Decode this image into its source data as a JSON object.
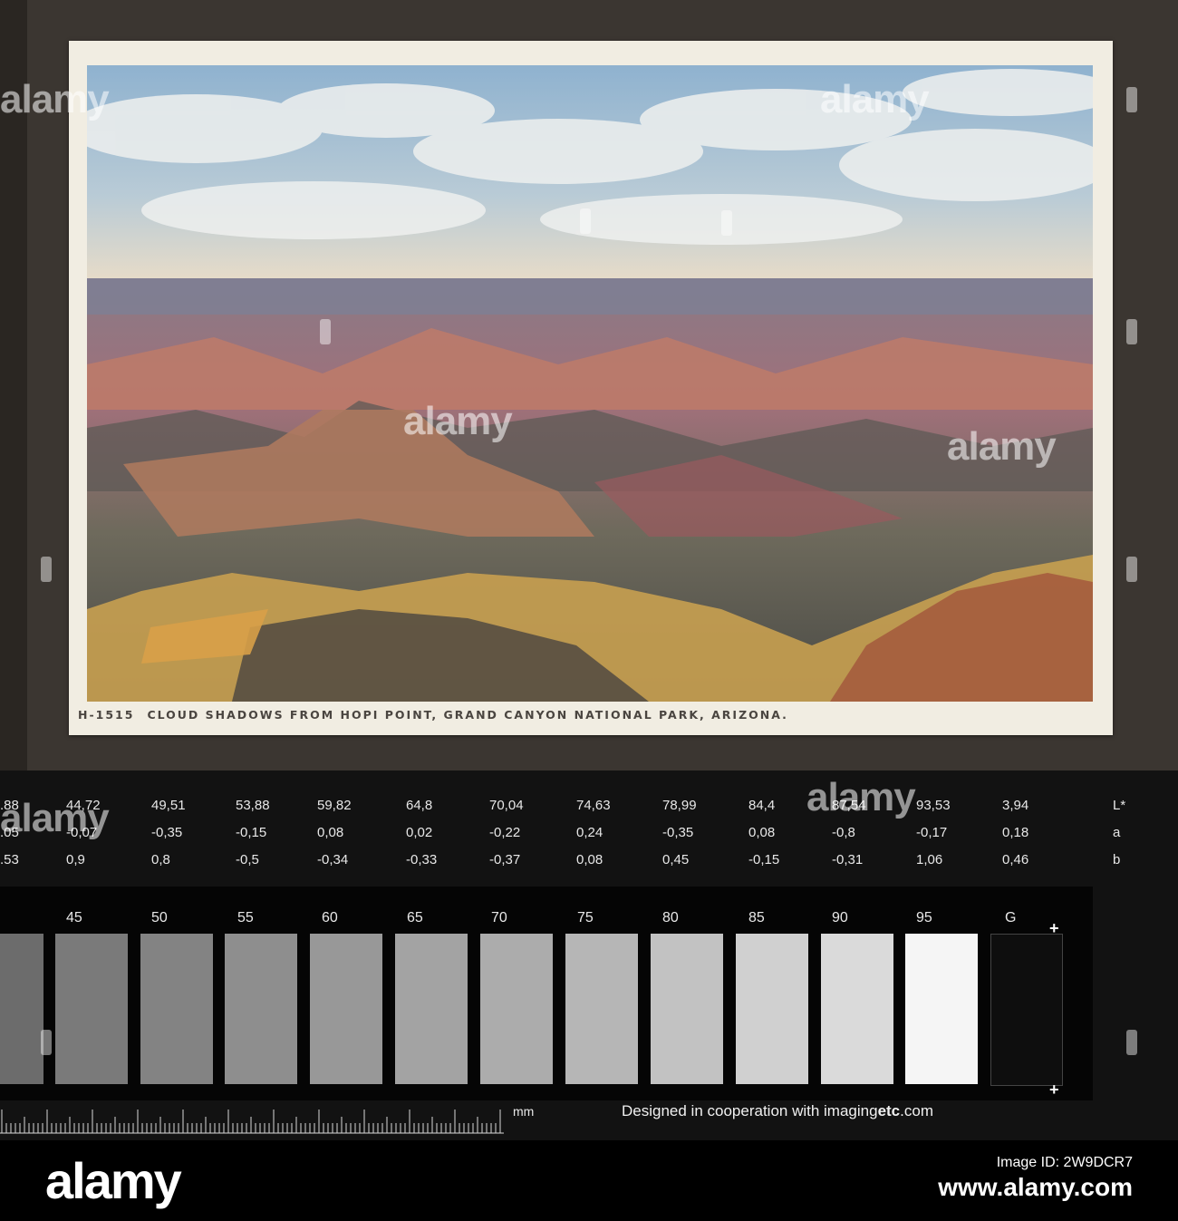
{
  "postcard": {
    "code": "H-1515",
    "caption": "CLOUD SHADOWS FROM HOPI POINT, GRAND CANYON NATIONAL PARK, ARIZONA."
  },
  "color_target": {
    "rows": [
      {
        "label": "L*",
        "values": [
          ".88",
          "44,72",
          "49,51",
          "53,88",
          "59,82",
          "64,8",
          "70,04",
          "74,63",
          "78,99",
          "84,4",
          "87,54",
          "93,53",
          "3,94"
        ]
      },
      {
        "label": "a",
        "values": [
          ".05",
          "-0,07",
          "-0,35",
          "-0,15",
          "0,08",
          "0,02",
          "-0,22",
          "0,24",
          "-0,35",
          "0,08",
          "-0,8",
          "-0,17",
          "0,18"
        ]
      },
      {
        "label": "b",
        "values": [
          ".53",
          "0,9",
          "0,8",
          "-0,5",
          "-0,34",
          "-0,33",
          "-0,37",
          "0,08",
          "0,45",
          "-0,15",
          "-0,31",
          "1,06",
          "0,46"
        ]
      }
    ],
    "scale_labels": [
      "45",
      "50",
      "55",
      "60",
      "65",
      "70",
      "75",
      "80",
      "85",
      "90",
      "95",
      "G"
    ],
    "patch_colors": [
      "#6c6c6c",
      "#7a7a7a",
      "#838383",
      "#8e8e8e",
      "#989898",
      "#a3a3a3",
      "#acacac",
      "#b6b6b6",
      "#c2c2c2",
      "#d0d0d0",
      "#dadada",
      "#f5f5f5",
      "#0e0e0e"
    ],
    "ruler_unit": "mm",
    "credit_prefix": "Designed in cooperation with imaging",
    "credit_bold": "etc",
    "credit_suffix": ".com"
  },
  "watermark": "alamy",
  "footer": {
    "brand": "alamy",
    "image_id_label": "Image ID: 2W9DCR7",
    "site": "www.alamy.com"
  }
}
